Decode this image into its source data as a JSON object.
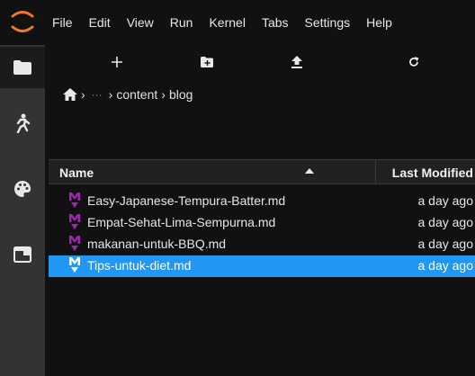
{
  "menubar": {
    "items": [
      "File",
      "Edit",
      "View",
      "Run",
      "Kernel",
      "Tabs",
      "Settings",
      "Help"
    ]
  },
  "activitybar": {
    "items": [
      "folder-icon",
      "running-icon",
      "palette-icon",
      "tabs-icon"
    ],
    "active": "folder-icon"
  },
  "toolbar": {
    "buttons": [
      "new-launcher-icon",
      "new-folder-icon",
      "upload-icon",
      "refresh-icon"
    ]
  },
  "breadcrumb": {
    "home_icon": "home-icon",
    "ellipsis": "···",
    "parts": [
      "content",
      "blog"
    ]
  },
  "file_table": {
    "columns": [
      "Name",
      "Last Modified"
    ],
    "sort": "ascending",
    "rows": [
      {
        "name": "Easy-Japanese-Tempura-Batter.md",
        "modified": "a day ago",
        "selected": false
      },
      {
        "name": "Empat-Sehat-Lima-Sempurna.md",
        "modified": "a day ago",
        "selected": false
      },
      {
        "name": "makanan-untuk-BBQ.md",
        "modified": "a day ago",
        "selected": false
      },
      {
        "name": "Tips-untuk-diet.md",
        "modified": "a day ago",
        "selected": true
      }
    ]
  },
  "colors": {
    "accent": "#2196f3",
    "markdown_icon": "#9c27b0",
    "logo": "#f37726"
  }
}
